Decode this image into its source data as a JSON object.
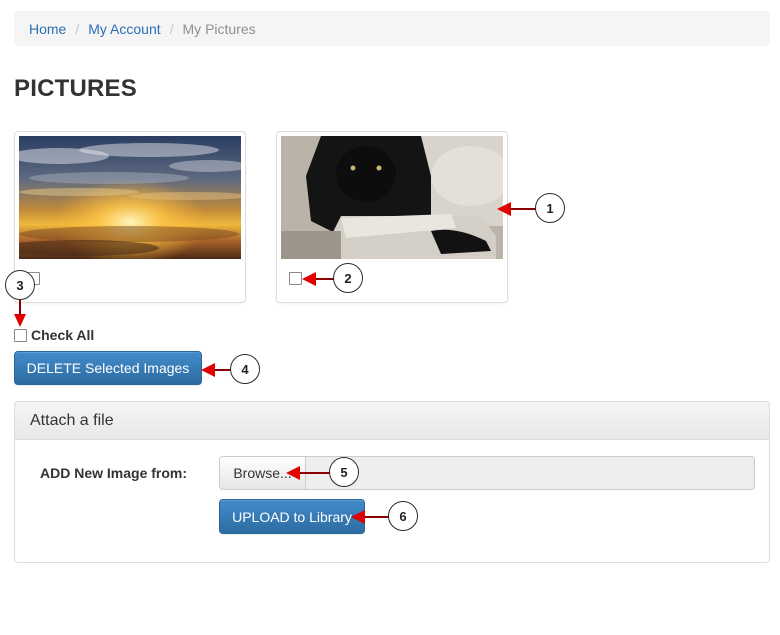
{
  "breadcrumb": {
    "home": "Home",
    "account": "My Account",
    "current": "My Pictures",
    "separator": "/"
  },
  "page": {
    "title": "PICTURES"
  },
  "pictures": [
    {
      "name": "sunset-clouds",
      "checked": false
    },
    {
      "name": "black-panther",
      "checked": false
    }
  ],
  "check_all": {
    "label": "Check All",
    "checked": false
  },
  "delete_button": {
    "label": "DELETE Selected Images"
  },
  "attach_panel": {
    "heading": "Attach a file",
    "field_label": "ADD New Image from:",
    "browse_label": "Browse...",
    "upload_label": "UPLOAD to Library"
  },
  "annotations": [
    "1",
    "2",
    "3",
    "4",
    "5",
    "6"
  ],
  "colors": {
    "link": "#2a6fb6",
    "primary": "#337ab7",
    "arrow": "#e00000"
  }
}
